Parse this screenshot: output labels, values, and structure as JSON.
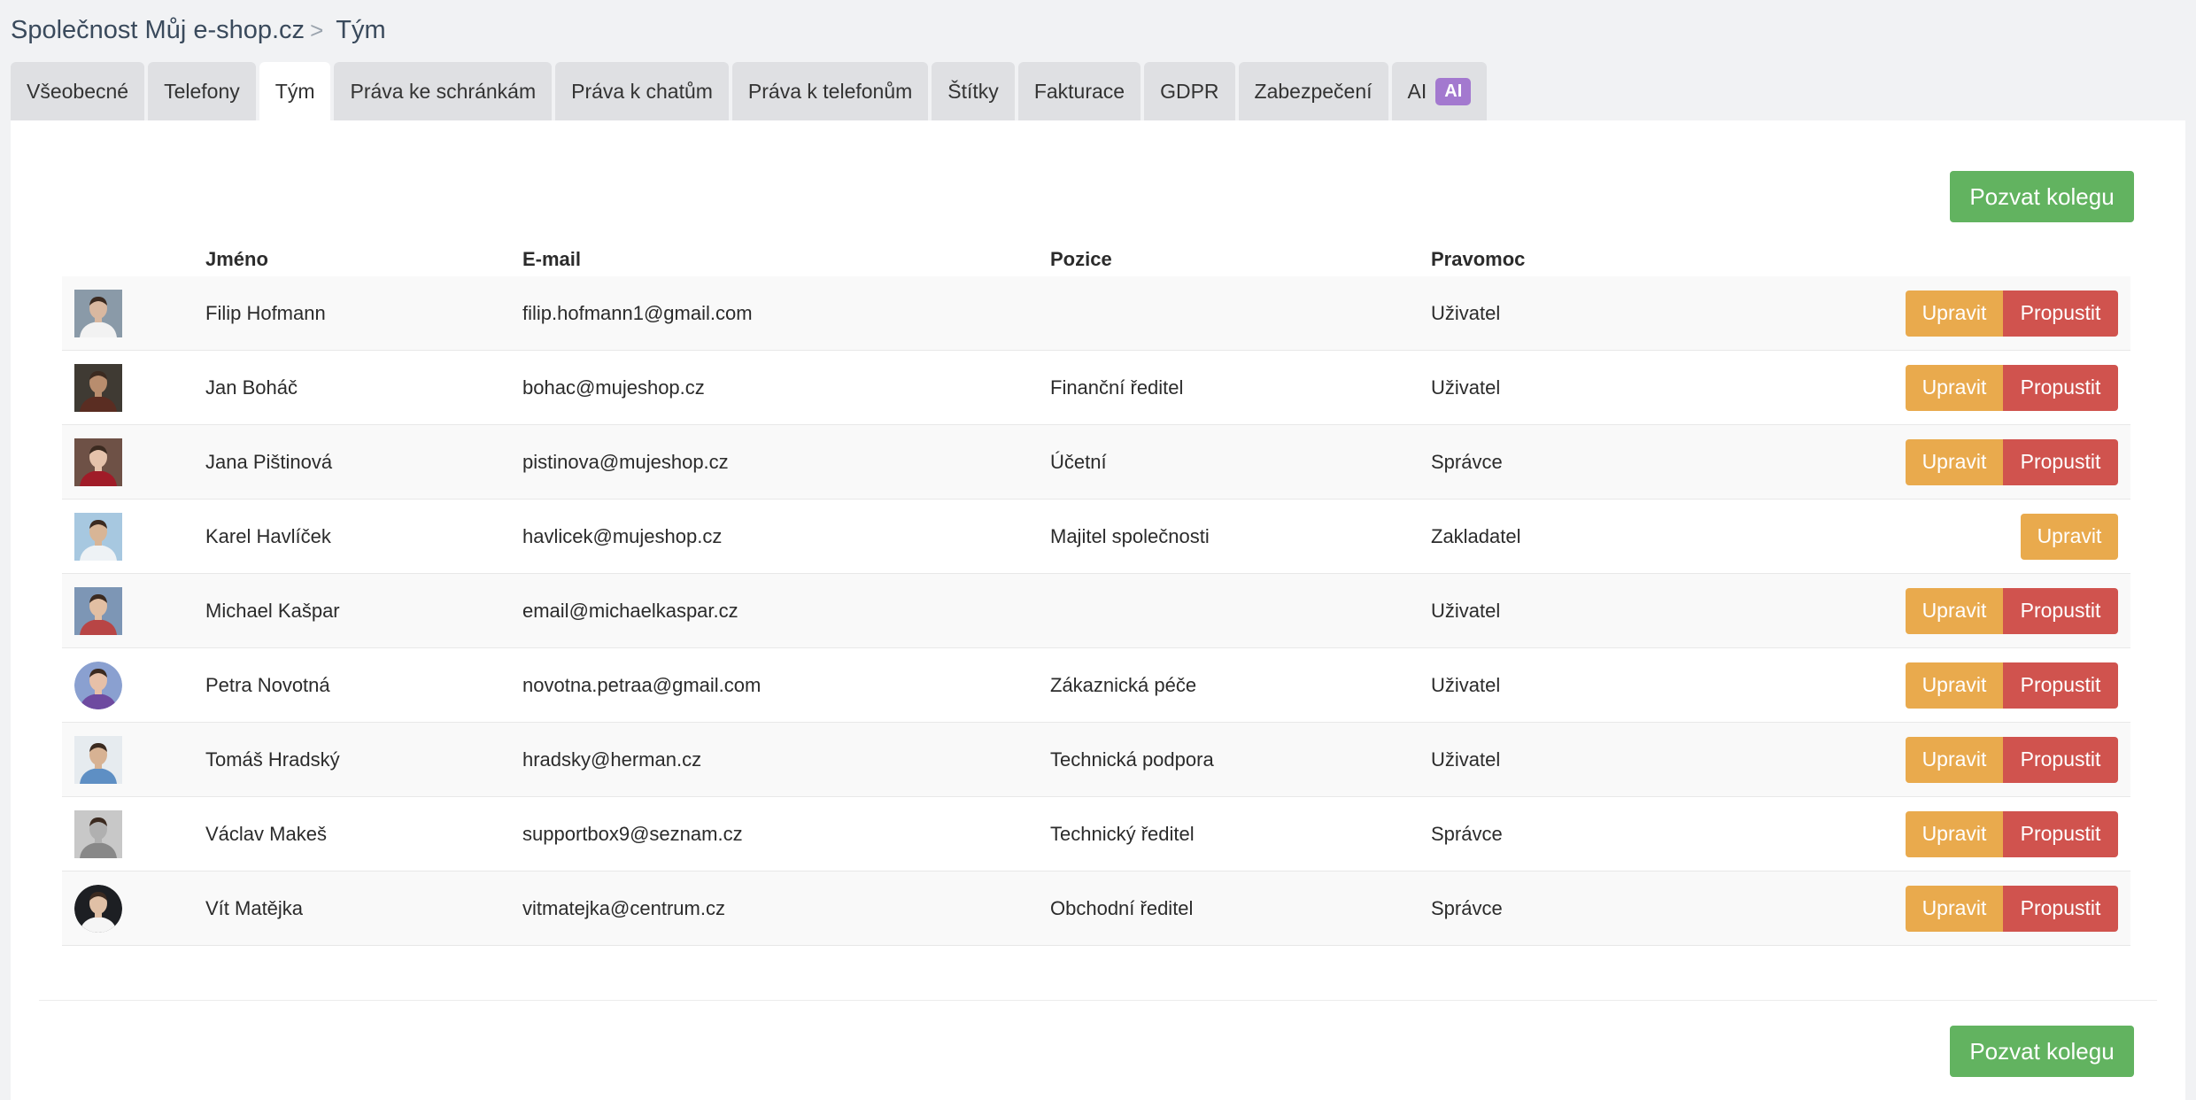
{
  "breadcrumb": {
    "company": "Společnost Můj e-shop.cz",
    "separator": ">",
    "current": "Tým"
  },
  "tabs": [
    {
      "label": "Všeobecné",
      "active": false
    },
    {
      "label": "Telefony",
      "active": false
    },
    {
      "label": "Tým",
      "active": true
    },
    {
      "label": "Práva ke schránkám",
      "active": false
    },
    {
      "label": "Práva k chatům",
      "active": false
    },
    {
      "label": "Práva k telefonům",
      "active": false
    },
    {
      "label": "Štítky",
      "active": false
    },
    {
      "label": "Fakturace",
      "active": false
    },
    {
      "label": "GDPR",
      "active": false
    },
    {
      "label": "Zabezpečení",
      "active": false
    },
    {
      "label": "AI",
      "active": false,
      "badge": "AI"
    }
  ],
  "invite_label": "Pozvat kolegu",
  "table": {
    "headers": {
      "name": "Jméno",
      "email": "E-mail",
      "position": "Pozice",
      "permission": "Pravomoc"
    },
    "edit_label": "Upravit",
    "fire_label": "Propustit",
    "rows": [
      {
        "name": "Filip Hofmann",
        "email": "filip.hofmann1@gmail.com",
        "position": "",
        "permission": "Uživatel",
        "can_fire": true,
        "avatar": {
          "bg": "#8a9aa8",
          "skin": "#d9b8a0",
          "shirt": "#f2f2f2",
          "round": false
        }
      },
      {
        "name": "Jan Boháč",
        "email": "bohac@mujeshop.cz",
        "position": "Finanční ředitel",
        "permission": "Uživatel",
        "can_fire": true,
        "avatar": {
          "bg": "#3f3a33",
          "skin": "#b88d6e",
          "shirt": "#5a2d22",
          "round": false
        }
      },
      {
        "name": "Jana Pištinová",
        "email": "pistinova@mujeshop.cz",
        "position": "Účetní",
        "permission": "Správce",
        "can_fire": true,
        "avatar": {
          "bg": "#6e5146",
          "skin": "#e5c2ab",
          "shirt": "#a01c28",
          "round": false
        }
      },
      {
        "name": "Karel Havlíček",
        "email": "havlicek@mujeshop.cz",
        "position": "Majitel společnosti",
        "permission": "Zakladatel",
        "can_fire": false,
        "avatar": {
          "bg": "#a7c8e0",
          "skin": "#d8b596",
          "shirt": "#eef2f5",
          "round": false
        }
      },
      {
        "name": "Michael Kašpar",
        "email": "email@michaelkaspar.cz",
        "position": "",
        "permission": "Uživatel",
        "can_fire": true,
        "avatar": {
          "bg": "#7d96b5",
          "skin": "#e2bfa3",
          "shirt": "#b84545",
          "round": false
        }
      },
      {
        "name": "Petra Novotná",
        "email": "novotna.petraa@gmail.com",
        "position": "Zákaznická péče",
        "permission": "Uživatel",
        "can_fire": true,
        "avatar": {
          "bg": "#8aa0d0",
          "skin": "#e6c0a8",
          "shirt": "#6e4aa0",
          "round": true
        }
      },
      {
        "name": "Tomáš Hradský",
        "email": "hradsky@herman.cz",
        "position": "Technická podpora",
        "permission": "Uživatel",
        "can_fire": true,
        "avatar": {
          "bg": "#e6ebef",
          "skin": "#d7b293",
          "shirt": "#5e8fc4",
          "round": false
        }
      },
      {
        "name": "Václav Makeš",
        "email": "supportbox9@seznam.cz",
        "position": "Technický ředitel",
        "permission": "Správce",
        "can_fire": true,
        "avatar": {
          "bg": "#c8c8c8",
          "skin": "#b0b0b0",
          "shirt": "#888888",
          "round": false
        }
      },
      {
        "name": "Vít Matějka",
        "email": "vitmatejka@centrum.cz",
        "position": "Obchodní ředitel",
        "permission": "Správce",
        "can_fire": true,
        "avatar": {
          "bg": "#1d1f23",
          "skin": "#e0c0a6",
          "shirt": "#f5f5f5",
          "round": true
        }
      }
    ]
  }
}
